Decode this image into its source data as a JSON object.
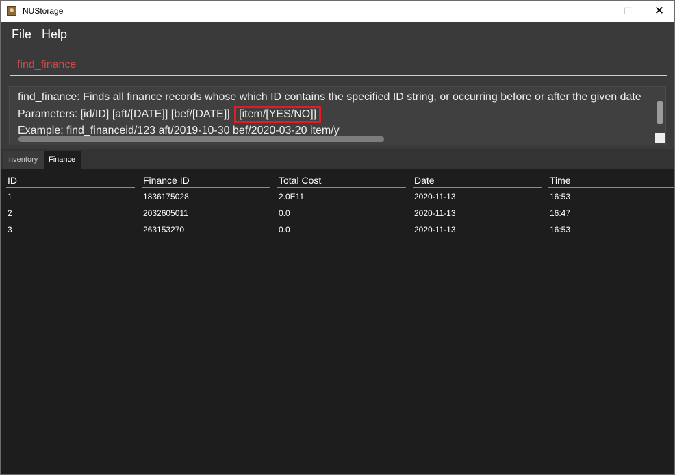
{
  "window": {
    "title": "NUStorage",
    "controls": {
      "minimize": "—",
      "maximize": "☐",
      "close": "✕"
    }
  },
  "menu": {
    "items": [
      "File",
      "Help"
    ]
  },
  "command": {
    "value": "find_finance"
  },
  "result": {
    "line1": "find_finance: Finds all finance records whose which ID contains the specified ID string, or occurring before or after the given date",
    "line2_params": "Parameters:  [id/ID] [aft/[DATE]] [bef/[DATE]]",
    "line2_highlight": "[item/[YES/NO]]",
    "line3": "Example: find_financeid/123 aft/2019-10-30 bef/2020-03-20 item/y"
  },
  "tabs": [
    {
      "label": "Inventory",
      "selected": false
    },
    {
      "label": "Finance",
      "selected": true
    }
  ],
  "table": {
    "columns": [
      "ID",
      "Finance ID",
      "Total Cost",
      "Date",
      "Time"
    ],
    "rows": [
      [
        "1",
        "1836175028",
        "2.0E11",
        "2020-11-13",
        "16:53"
      ],
      [
        "2",
        "2032605011",
        "0.0",
        "2020-11-13",
        "16:47"
      ],
      [
        "3",
        "263153270",
        "0.0",
        "2020-11-13",
        "16:53"
      ]
    ]
  },
  "colors": {
    "command_text": "#d04c4c",
    "highlight_border": "#e21b24",
    "panel_background": "#3a3a3a",
    "table_background": "#1d1d1d"
  }
}
